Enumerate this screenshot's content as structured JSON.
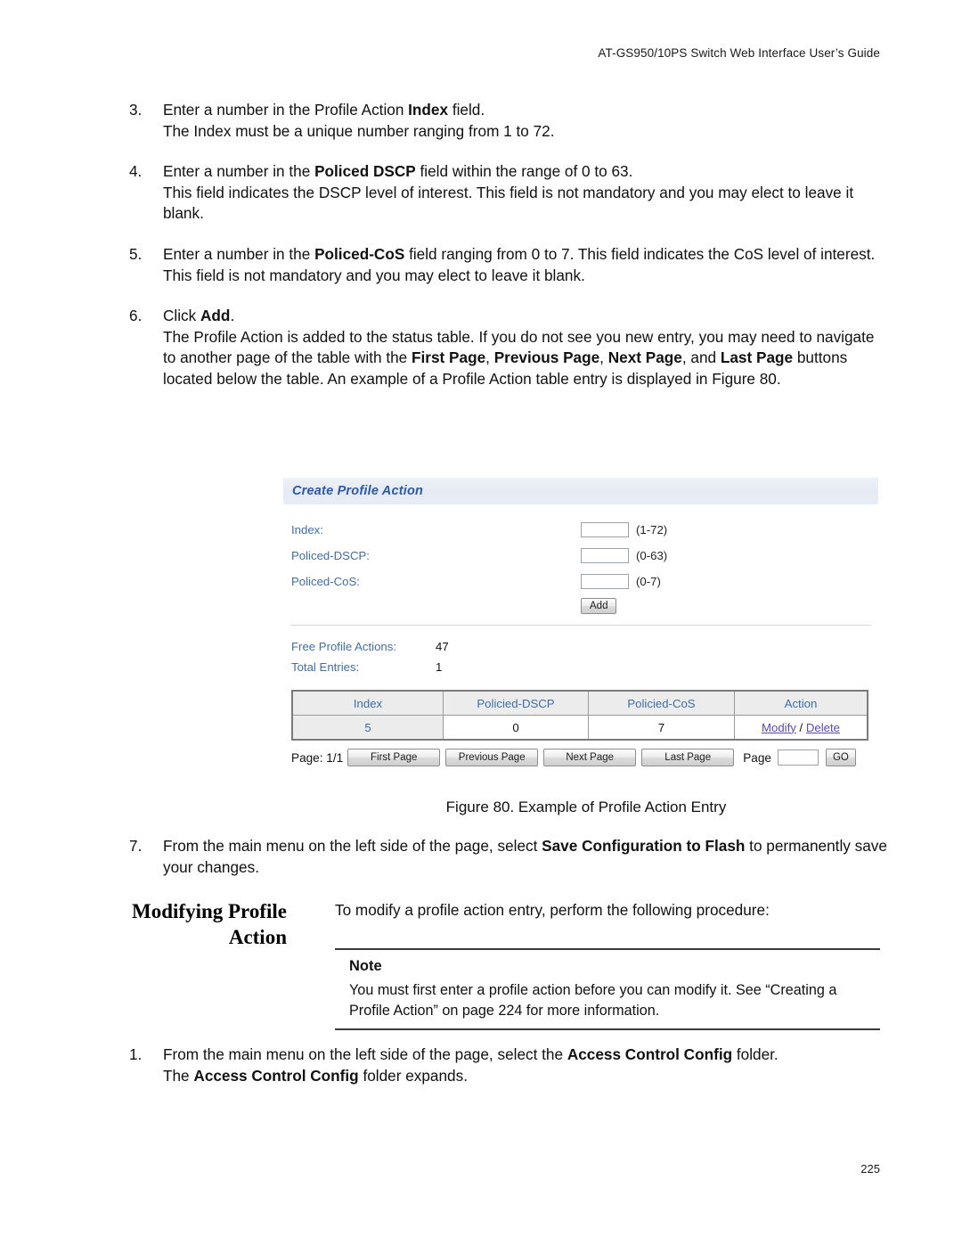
{
  "header": {
    "running_head": "AT-GS950/10PS Switch Web Interface User’s Guide"
  },
  "steps_top": [
    {
      "num": "3.",
      "line1_a": "Enter a number in the Profile Action ",
      "line1_b": "Index",
      "line1_c": " field.",
      "line2": "The Index must be a unique number ranging from 1 to 72."
    },
    {
      "num": "4.",
      "line1_a": "Enter a number in the ",
      "line1_b": "Policed DSCP",
      "line1_c": " field within the range of 0 to 63.",
      "line2": "This field indicates the DSCP level of interest. This field is not mandatory and you may elect to leave it blank."
    },
    {
      "num": "5.",
      "line1_a": "Enter a number in the ",
      "line1_b": "Policed-CoS",
      "line1_c": " field ranging from 0 to 7. This field indicates the CoS level of interest. This field is not mandatory and you may elect to leave it blank."
    },
    {
      "num": "6.",
      "click_a": "Click ",
      "click_b": "Add",
      "click_c": ".",
      "body_1": "The Profile Action is added to the status table. If you do not see you new entry, you may need to navigate to another page of the table with the ",
      "body_b1": "First Page",
      "body_2": ", ",
      "body_b2": "Previous Page",
      "body_3": ", ",
      "body_b3": "Next Page",
      "body_4": ", and ",
      "body_b4": "Last Page",
      "body_5": " buttons located below the table. An example of a Profile Action table entry is displayed in Figure 80."
    }
  ],
  "figure": {
    "panel_title": "Create Profile Action",
    "form": {
      "fields": [
        {
          "label": "Index:",
          "value": "",
          "hint": "(1-72)"
        },
        {
          "label": "Policed-DSCP:",
          "value": "",
          "hint": "(0-63)"
        },
        {
          "label": "Policed-CoS:",
          "value": "",
          "hint": "(0-7)"
        }
      ],
      "add_button": "Add"
    },
    "stats": [
      {
        "label": "Free Profile Actions:",
        "value": "47"
      },
      {
        "label": "Total Entries:",
        "value": "1"
      }
    ],
    "table": {
      "columns": [
        "Index",
        "Policied-DSCP",
        "Policied-CoS",
        "Action"
      ],
      "rows": [
        {
          "index": "5",
          "policied_dscp": "0",
          "policied_cos": "7",
          "action_modify": "Modify",
          "action_sep": " / ",
          "action_delete": "Delete"
        }
      ]
    },
    "pagination": {
      "page_status": "Page: 1/1",
      "first": "First Page",
      "previous": "Previous Page",
      "next": "Next Page",
      "last": "Last Page",
      "page_word": "Page",
      "page_input_value": "",
      "go": "GO"
    },
    "colors": {
      "titlebar_bg": "#e9edf5",
      "title_text": "#2c5aa8",
      "label_text": "#3f6ea8",
      "link_text": "#5b4ab5",
      "table_header_bg": "#ececec"
    }
  },
  "figure_caption": "Figure 80. Example of Profile Action Entry",
  "step7": {
    "num": "7.",
    "a": "From the main menu on the left side of the page, select ",
    "b": "Save Configuration to Flash",
    "c": " to permanently save your changes."
  },
  "section": {
    "heading_line1": "Modifying Profile",
    "heading_line2": "Action",
    "intro": "To modify a profile action entry, perform the following procedure:"
  },
  "note": {
    "title": "Note",
    "text": "You must first enter a profile action before you can modify it. See “Creating a Profile Action” on page 224 for more information."
  },
  "step_final": {
    "num": "1.",
    "a": "From the main menu on the left side of the page, select the ",
    "b": "Access Control Config",
    "c": " folder.",
    "d": "The ",
    "e": "Access Control Config",
    "f": " folder expands."
  },
  "page_number": "225"
}
